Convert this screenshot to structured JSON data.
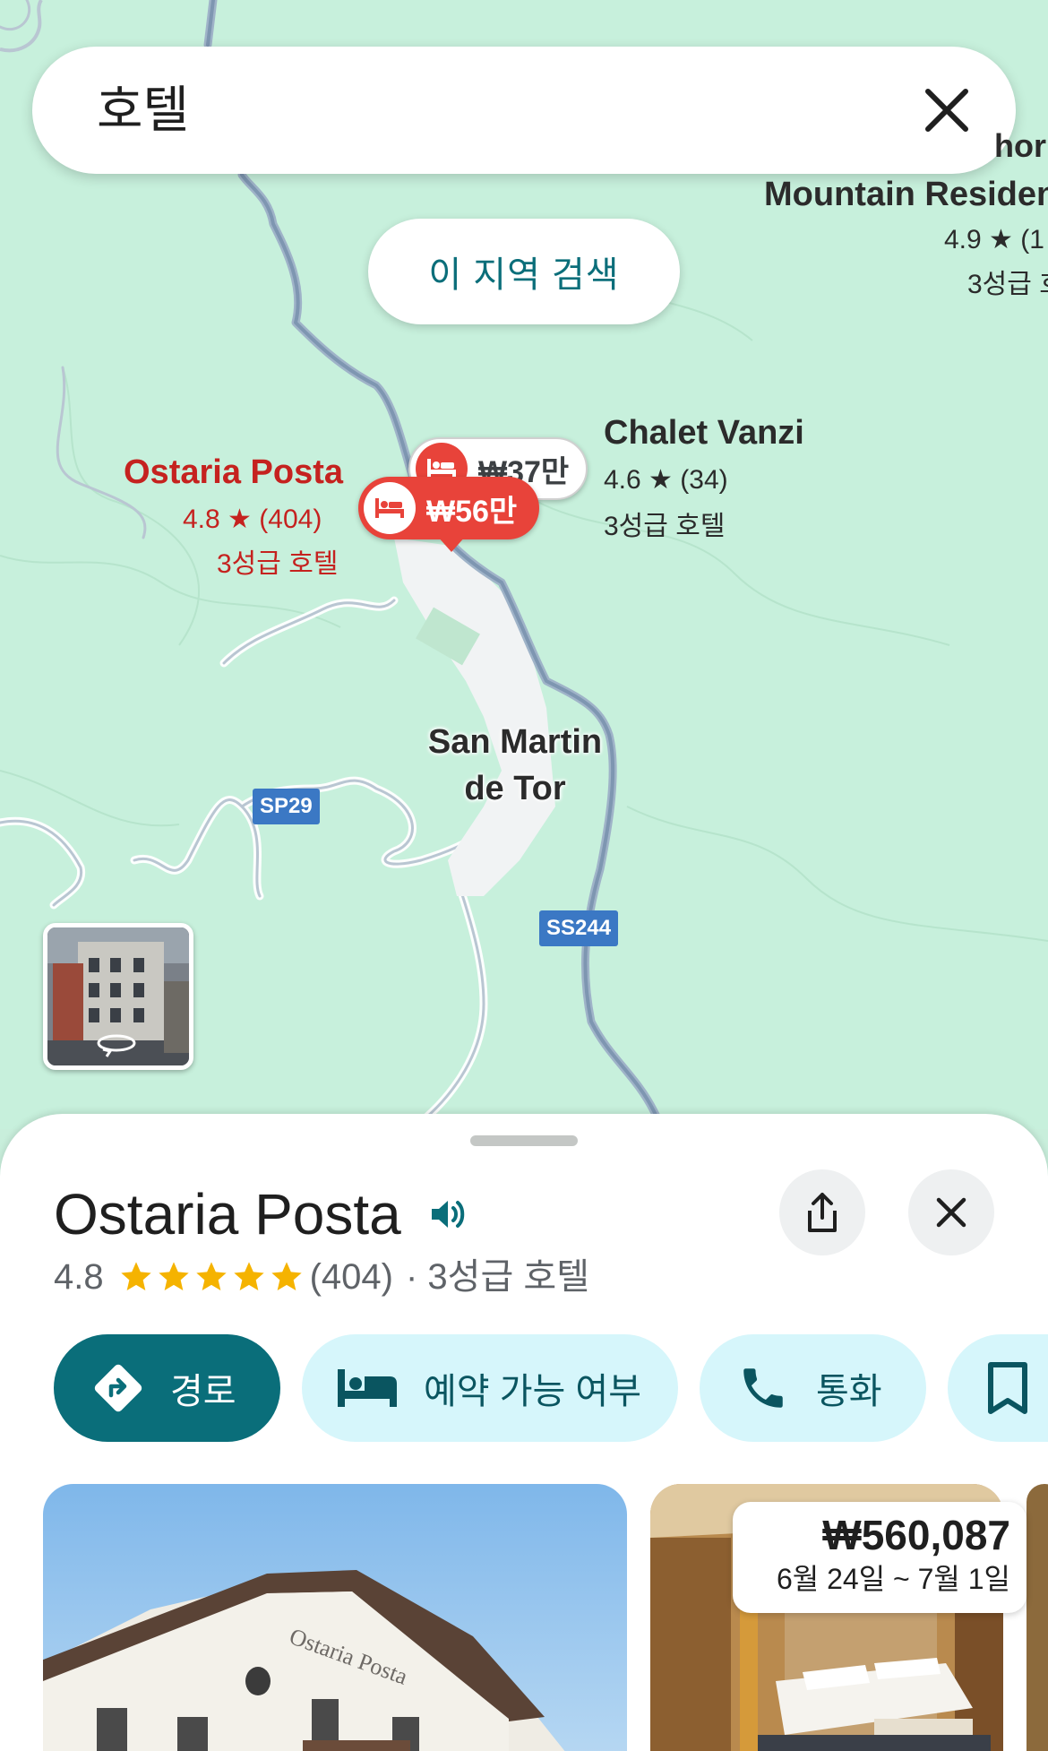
{
  "search": {
    "query": "호텔"
  },
  "map": {
    "area_search_label": "이 지역 검색",
    "pois": [
      {
        "name": "Ostaria Posta",
        "rating": "4.8 ★ (404)",
        "type": "3성급 호텔",
        "color": "#c5221f"
      },
      {
        "name": "Chalet Vanzi",
        "rating": "4.6 ★ (34)",
        "type": "3성급 호텔",
        "color": "#2b2b2b"
      },
      {
        "name": "Mountain Residen",
        "name_top": "hor",
        "rating": "4.9 ★ (1",
        "type": "3성급 호",
        "color": "#2b2b2b"
      }
    ],
    "pins": [
      {
        "price": "₩37만",
        "selected": false
      },
      {
        "price": "₩56만",
        "selected": true
      }
    ],
    "town": {
      "line1": "San Martin",
      "line2": "de Tor"
    },
    "roads": [
      "SP29",
      "SS244"
    ],
    "streetview_icon": "360-rotate-icon"
  },
  "place": {
    "title": "Ostaria Posta",
    "rating": "4.8",
    "stars": 5,
    "review_count": "(404)",
    "category": "· 3성급 호텔",
    "actions": [
      {
        "label": "경로",
        "icon": "directions-icon"
      },
      {
        "label": "예약 가능 여부",
        "icon": "bed-icon"
      },
      {
        "label": "통화",
        "icon": "phone-icon"
      },
      {
        "label": "",
        "icon": "bookmark-icon"
      }
    ],
    "price_card": {
      "price": "₩560,087",
      "dates": "6월 24일 ~ 7월 1일"
    },
    "photo_sign": "Ostaria Posta"
  },
  "colors": {
    "accent": "#0a6e7a",
    "chip_bg": "#d6f6fb",
    "map_bg": "#c7f0dc",
    "selected_poi": "#c5221f",
    "pin_red": "#e8433a",
    "star": "#f5b300"
  }
}
